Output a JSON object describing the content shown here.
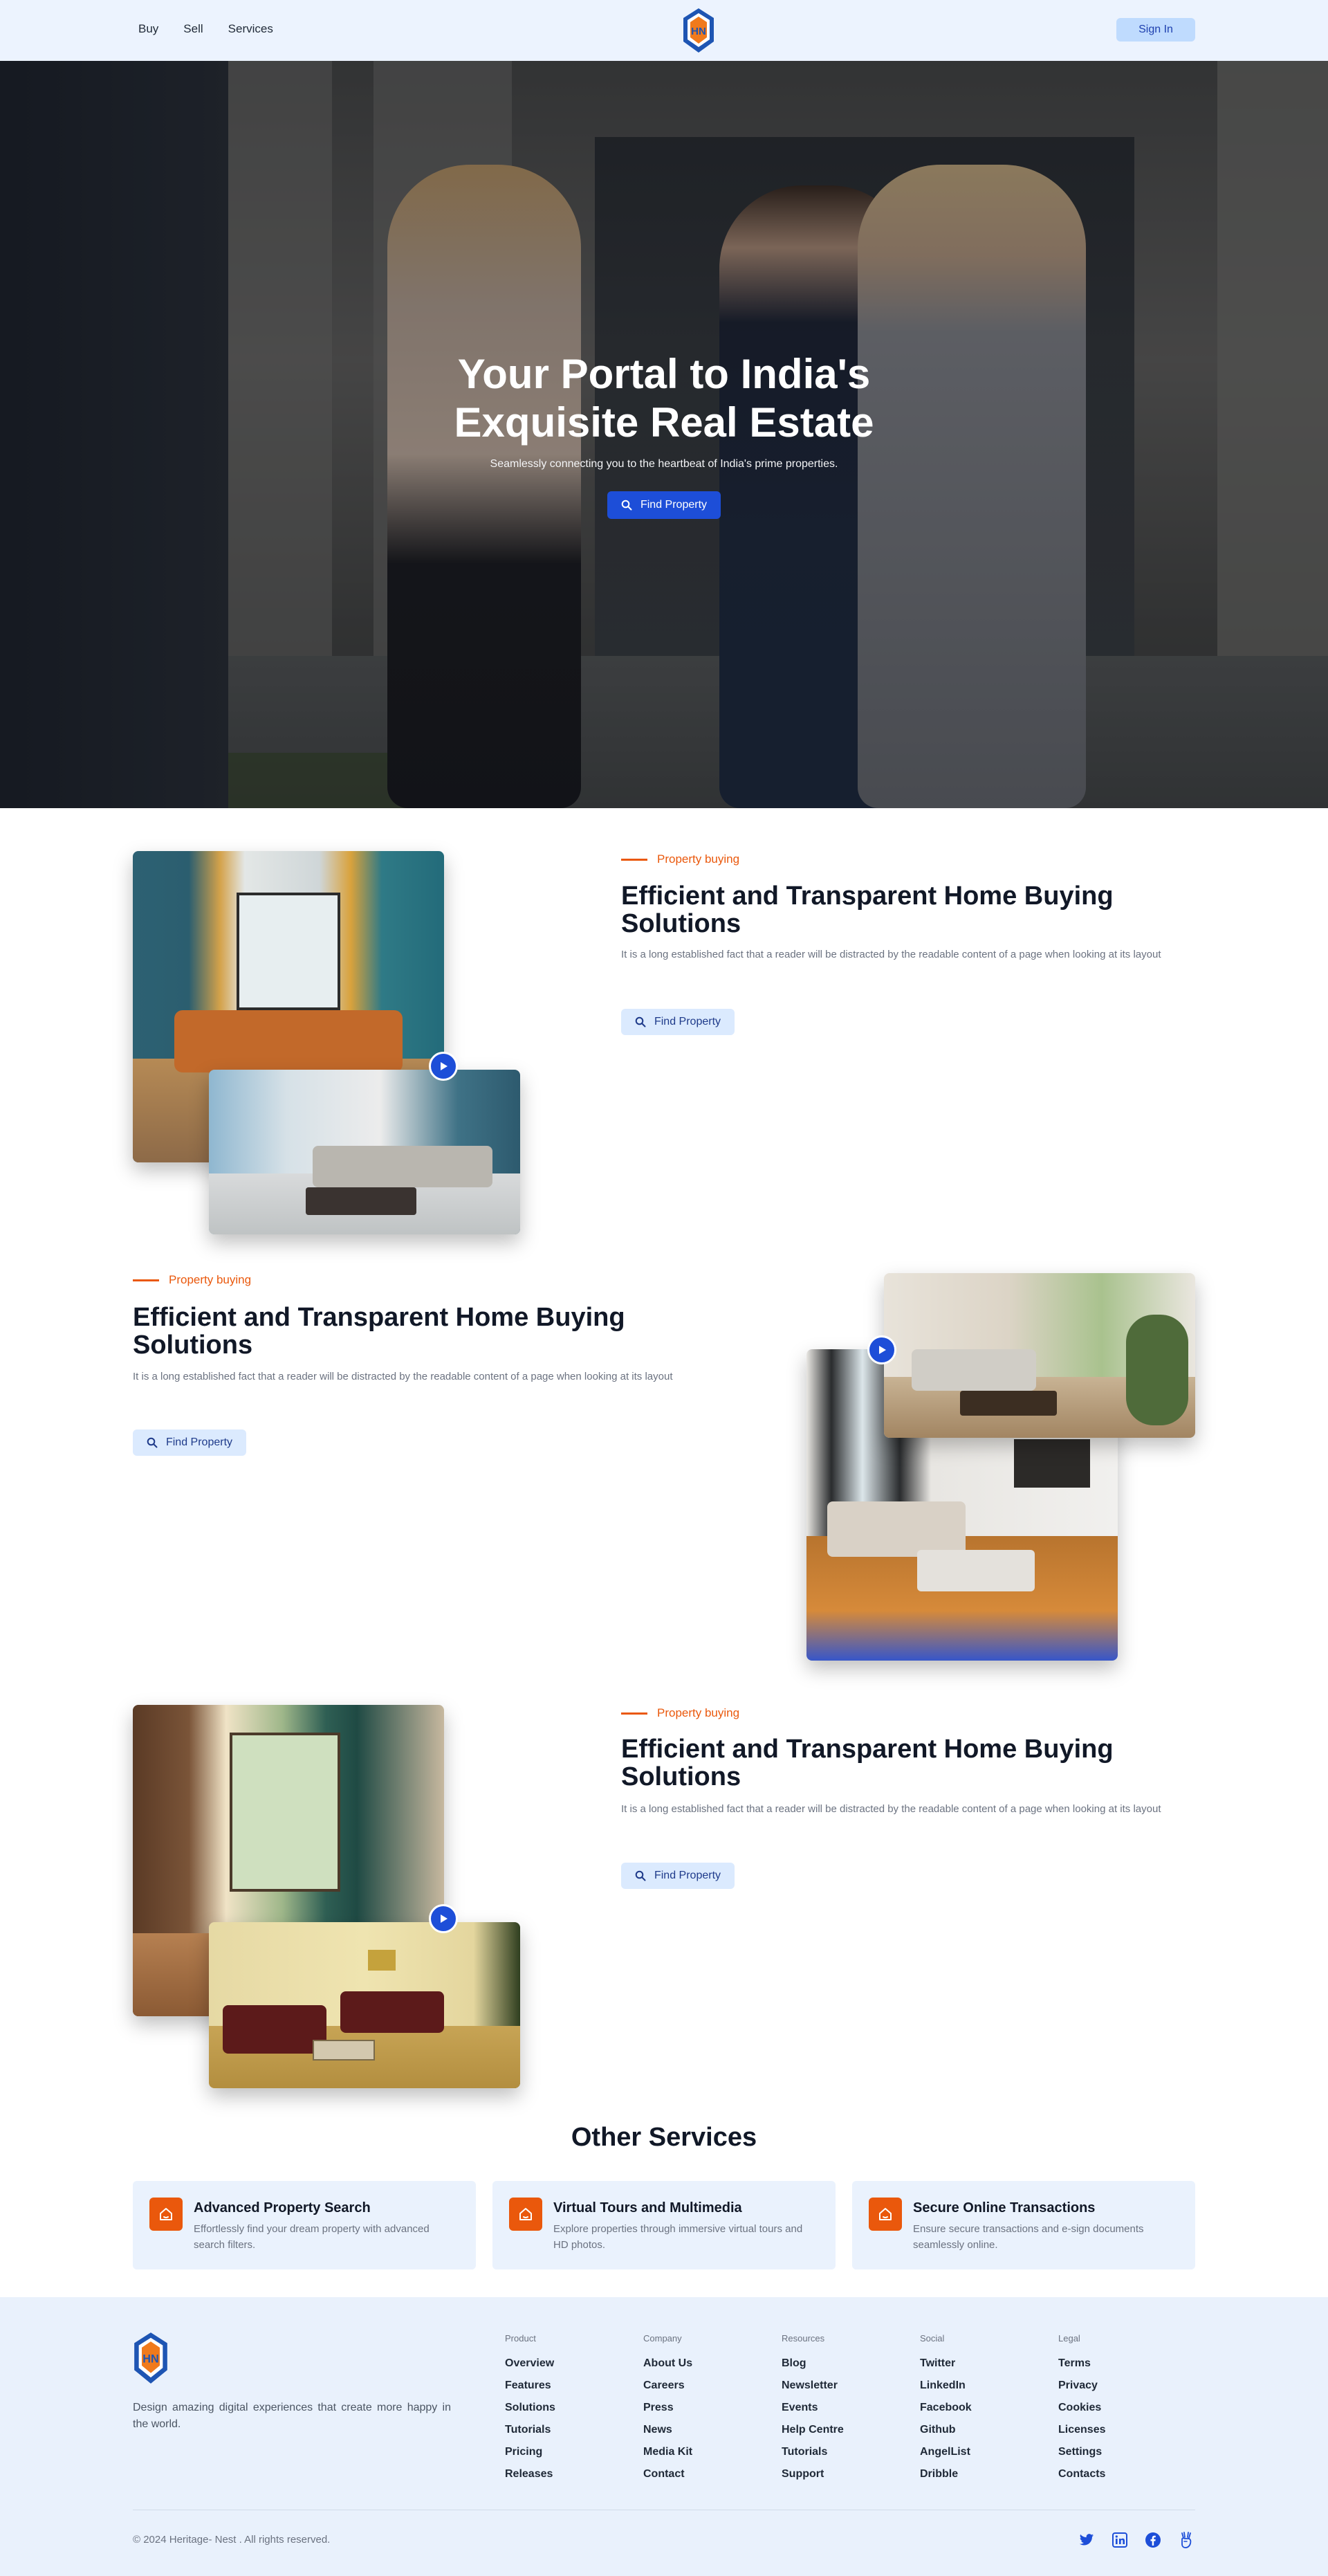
{
  "nav": {
    "links": [
      "Buy",
      "Sell",
      "Services"
    ],
    "signin_label": "Sign In",
    "logo_text": "HN"
  },
  "hero": {
    "title_line1": "Your Portal to India's",
    "title_line2": "Exquisite Real Estate",
    "subtitle": "Seamlessly connecting you to the heartbeat of India's prime properties.",
    "button_label": "Find Property"
  },
  "features": [
    {
      "eyebrow": "Property buying",
      "title_line1": "Efficient and Transparent Home Buying",
      "title_line2": "Solutions",
      "description": "It is a long established fact that a reader will be distracted by the readable content of a page when looking at its layout",
      "button_label": "Find Property"
    },
    {
      "eyebrow": "Property buying",
      "title_line1": "Efficient and Transparent Home Buying",
      "title_line2": "Solutions",
      "description": "It is a long established fact that a reader will be distracted by the readable content of a page when looking at its layout",
      "button_label": "Find Property"
    },
    {
      "eyebrow": "Property buying",
      "title_line1": "Efficient and Transparent Home Buying",
      "title_line2": "Solutions",
      "description": "It is a long established fact that a reader will be distracted by the readable content of a page when looking at its layout",
      "button_label": "Find Property"
    }
  ],
  "other_services": {
    "title": "Other Services",
    "items": [
      {
        "title": "Advanced Property Search",
        "description": "Effortlessly find your dream property with advanced search filters.",
        "icon": "home-icon"
      },
      {
        "title": "Virtual Tours and Multimedia",
        "description": "Explore properties through immersive virtual tours and HD photos.",
        "icon": "home-icon"
      },
      {
        "title": "Secure Online Transactions",
        "description": "Ensure secure transactions and e-sign documents seamlessly online.",
        "icon": "home-icon"
      }
    ]
  },
  "footer": {
    "tagline": "Design amazing digital experiences that create more happy in the world.",
    "columns": [
      {
        "heading": "Product",
        "links": [
          "Overview",
          "Features",
          "Solutions",
          "Tutorials",
          "Pricing",
          "Releases"
        ]
      },
      {
        "heading": "Company",
        "links": [
          "About Us",
          "Careers",
          "Press",
          "News",
          "Media Kit",
          "Contact"
        ]
      },
      {
        "heading": "Resources",
        "links": [
          "Blog",
          "Newsletter",
          "Events",
          "Help Centre",
          "Tutorials",
          "Support"
        ]
      },
      {
        "heading": "Social",
        "links": [
          "Twitter",
          "LinkedIn",
          "Facebook",
          "Github",
          "AngelList",
          "Dribble"
        ]
      },
      {
        "heading": "Legal",
        "links": [
          "Terms",
          "Privacy",
          "Cookies",
          "Licenses",
          "Settings",
          "Contacts"
        ]
      }
    ],
    "copyright": "© 2024 Heritage- Nest . All rights reserved.",
    "social_icons": [
      "twitter-icon",
      "linkedin-icon",
      "facebook-icon",
      "angellist-icon"
    ]
  },
  "colors": {
    "primary": "#1d4ed8",
    "accent": "#ea580c",
    "nav_bg": "#ecf3fe",
    "card_bg": "#eaf2fd"
  }
}
